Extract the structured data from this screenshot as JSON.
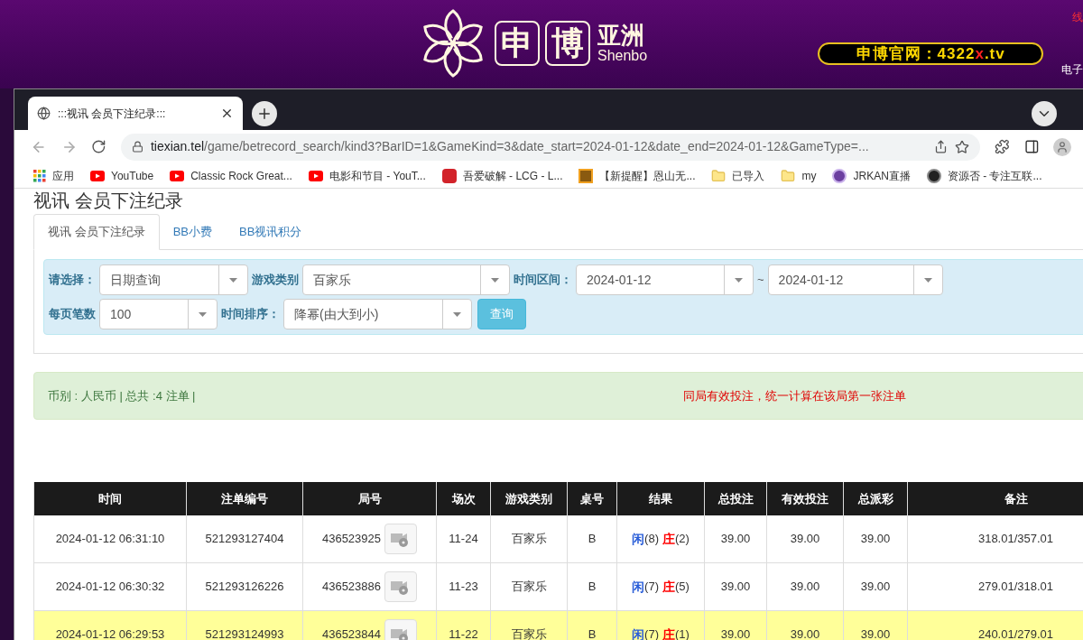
{
  "site_header": {
    "logo_chars": [
      "申",
      "博"
    ],
    "logo_region": "亚洲",
    "logo_latin": "Shenbo",
    "official_label": "申博官网：4322",
    "official_mark": "x",
    "official_suffix": ".tv",
    "edge_top": "线",
    "edge_bottom": "电子"
  },
  "browser": {
    "tab_title": ":::视讯 会员下注纪录:::",
    "url_host": "tiexian.tel",
    "url_path": "/game/betrecord_search/kind3?BarID=1&GameKind=3&date_start=2024-01-12&date_end=2024-01-12&GameType=...",
    "bookmarks": [
      {
        "kind": "apps",
        "label": "应用"
      },
      {
        "kind": "youtube",
        "label": "YouTube"
      },
      {
        "kind": "youtube",
        "label": "Classic Rock Great..."
      },
      {
        "kind": "youtube",
        "label": "电影和节目 - YouT..."
      },
      {
        "kind": "seal",
        "label": "吾爱破解 - LCG - L..."
      },
      {
        "kind": "square",
        "label": "【新提醒】恩山无..."
      },
      {
        "kind": "folder",
        "label": "已导入"
      },
      {
        "kind": "folder",
        "label": "my"
      },
      {
        "kind": "badge",
        "label": "JRKAN直播"
      },
      {
        "kind": "dark",
        "label": "资源否 - 专注互联..."
      }
    ]
  },
  "page": {
    "heading": "视讯 会员下注纪录",
    "tabs": [
      {
        "label": "视讯 会员下注纪录",
        "selected": true
      },
      {
        "label": "BB小费",
        "selected": false
      },
      {
        "label": "BB视讯积分",
        "selected": false
      }
    ],
    "filters": {
      "select_label": "请选择：",
      "select_value": "日期查询",
      "game_label": "游戏类别",
      "game_value": "百家乐",
      "range_label": "时间区间：",
      "date_from": "2024-01-12",
      "range_sep": "~",
      "date_to": "2024-01-12",
      "per_page_label": "每页笔数",
      "per_page_value": "100",
      "sort_label": "时间排序：",
      "sort_value": "降幂(由大到小)",
      "query_button": "查询"
    },
    "info": {
      "summary": "币别 : 人民币 | 总共 :4 注单 |",
      "notice": "同局有效投注，统一计算在该局第一张注单"
    },
    "table": {
      "columns": [
        "时间",
        "注单编号",
        "局号",
        "场次",
        "游戏类别",
        "桌号",
        "结果",
        "总投注",
        "有效投注",
        "总派彩",
        "备注"
      ],
      "rows": [
        {
          "highlighted": false,
          "time": "2024-01-12 06:31:10",
          "order_no": "521293127404",
          "round_no": "436523925",
          "session": "11-24",
          "game": "百家乐",
          "table": "B",
          "result": [
            {
              "color": "#2a5ed8",
              "label": "闲",
              "value": "(8)"
            },
            {
              "color": "#ff0000",
              "label": "庄",
              "value": "(2)"
            }
          ],
          "total_bet": "39.00",
          "valid_bet": "39.00",
          "payout": "39.00",
          "note": "318.01/357.01"
        },
        {
          "highlighted": false,
          "time": "2024-01-12 06:30:32",
          "order_no": "521293126226",
          "round_no": "436523886",
          "session": "11-23",
          "game": "百家乐",
          "table": "B",
          "result": [
            {
              "color": "#2a5ed8",
              "label": "闲",
              "value": "(7)"
            },
            {
              "color": "#ff0000",
              "label": "庄",
              "value": "(5)"
            }
          ],
          "total_bet": "39.00",
          "valid_bet": "39.00",
          "payout": "39.00",
          "note": "279.01/318.01"
        },
        {
          "highlighted": true,
          "time": "2024-01-12 06:29:53",
          "order_no": "521293124993",
          "round_no": "436523844",
          "session": "11-22",
          "game": "百家乐",
          "table": "B",
          "result": [
            {
              "color": "#2a5ed8",
              "label": "闲",
              "value": "(7)"
            },
            {
              "color": "#ff0000",
              "label": "庄",
              "value": "(1)"
            }
          ],
          "total_bet": "39.00",
          "valid_bet": "39.00",
          "payout": "39.00",
          "note": "240.01/279.01"
        }
      ]
    }
  }
}
